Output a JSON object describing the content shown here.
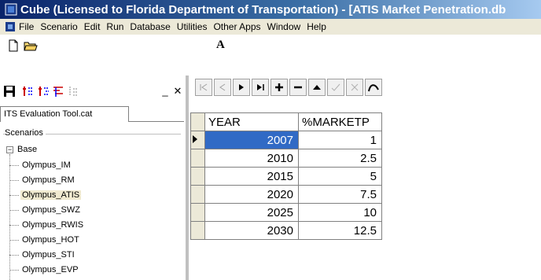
{
  "window": {
    "title": "Cube (Licensed to Florida Department of Transportation) - [ATIS Market Penetration.db"
  },
  "menubar": {
    "items": [
      "File",
      "Scenario",
      "Edit",
      "Run",
      "Database",
      "Utilities",
      "Other Apps",
      "Window",
      "Help"
    ]
  },
  "toolbar": {
    "font_button": "A"
  },
  "left_panel": {
    "tab_label": "ITS Evaluation Tool.cat",
    "group_label": "Scenarios",
    "tree_root": "Base",
    "tree_items": [
      "Olympus_IM",
      "Olympus_RM",
      "Olympus_ATIS",
      "Olympus_SWZ",
      "Olympus_RWIS",
      "Olympus_HOT",
      "Olympus_STI",
      "Olympus_EVP"
    ],
    "selected_item": "Olympus_ATIS"
  },
  "table": {
    "columns": [
      "YEAR",
      "%MARKETP"
    ],
    "rows": [
      [
        "2007",
        "1"
      ],
      [
        "2010",
        "2.5"
      ],
      [
        "2015",
        "5"
      ],
      [
        "2020",
        "7.5"
      ],
      [
        "2025",
        "10"
      ],
      [
        "2030",
        "12.5"
      ]
    ]
  },
  "colors": {
    "selection": "#316ac5",
    "title_gradient_start": "#0a246a"
  }
}
